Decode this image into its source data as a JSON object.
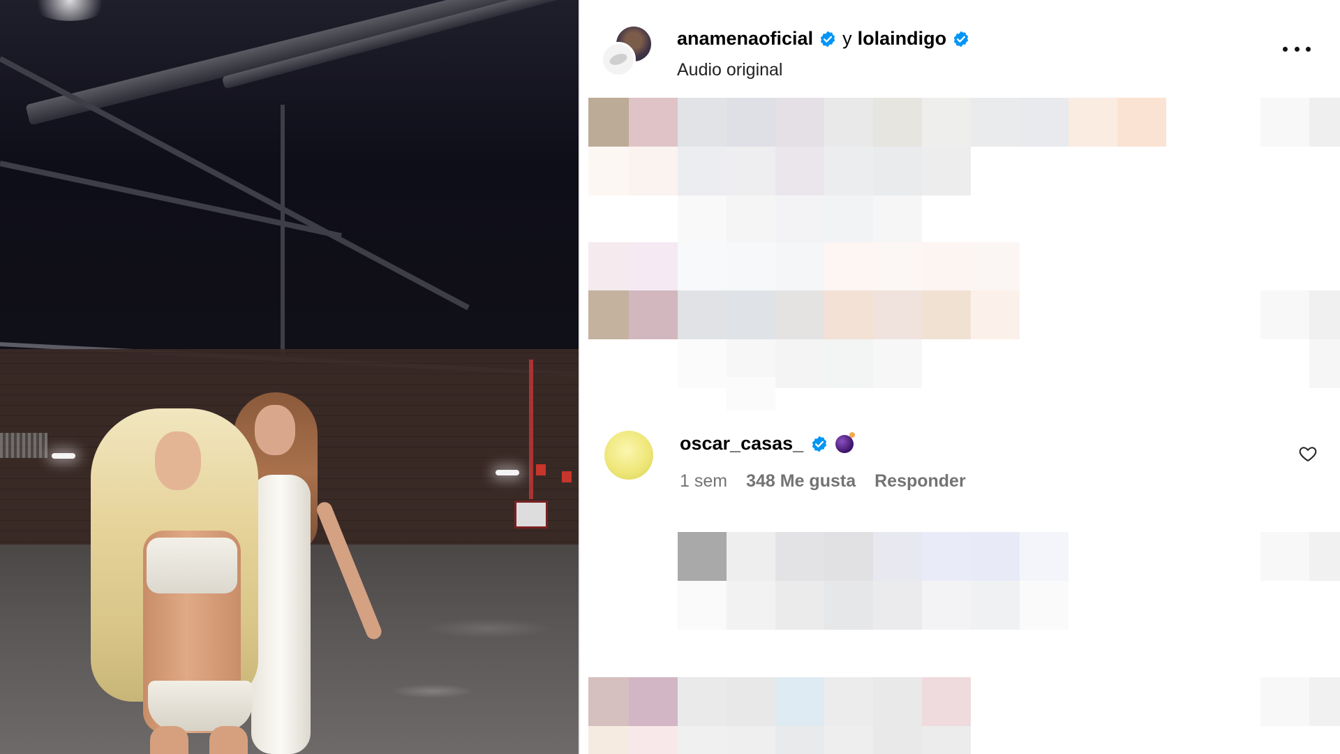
{
  "post": {
    "author1": "anamenaoficial",
    "conjunction": "y",
    "author2": "lolaindigo",
    "audio_label": "Audio original"
  },
  "comment": {
    "username": "oscar_casas_",
    "time": "1 sem",
    "likes": "348 Me gusta",
    "reply_label": "Responder"
  },
  "icons": {
    "verified": "verified-badge-icon",
    "more": "more-options-icon",
    "heart": "heart-icon",
    "emoji": "bomb-emoji-icon"
  },
  "colors": {
    "verified": "#0095f6",
    "meta_text": "#737373"
  }
}
